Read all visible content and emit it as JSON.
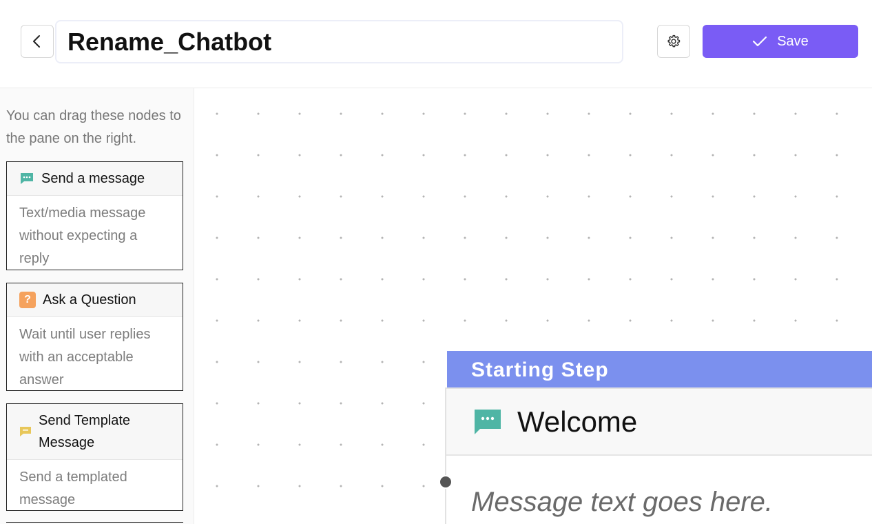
{
  "header": {
    "chatbot_name": "Rename_Chatbot",
    "save_label": "Save",
    "back_icon": "chevron-left-icon",
    "settings_icon": "gear-icon",
    "save_icon": "check-icon"
  },
  "sidebar": {
    "hint": "You can drag these nodes to the pane on the right.",
    "nodes": [
      {
        "title": "Send a message",
        "description": "Text/media message without expecting a reply",
        "icon": "message-bubble-icon",
        "icon_color": "#4fb5a5"
      },
      {
        "title": "Ask a Question",
        "description": "Wait until user replies with an acceptable answer",
        "icon": "question-icon",
        "icon_badge": "?",
        "icon_color": "#f5a25d"
      },
      {
        "title": "Send Template Message",
        "description": "Send a templated message",
        "icon": "template-message-icon",
        "icon_color": "#e8c75a"
      }
    ]
  },
  "canvas": {
    "starting_step": {
      "banner": "Starting Step",
      "title": "Welcome",
      "message": "Message text goes here.",
      "icon": "message-bubble-icon",
      "banner_color": "#7b90ee",
      "icon_color": "#4fb5a5"
    }
  },
  "colors": {
    "accent": "#7a5cf5"
  }
}
